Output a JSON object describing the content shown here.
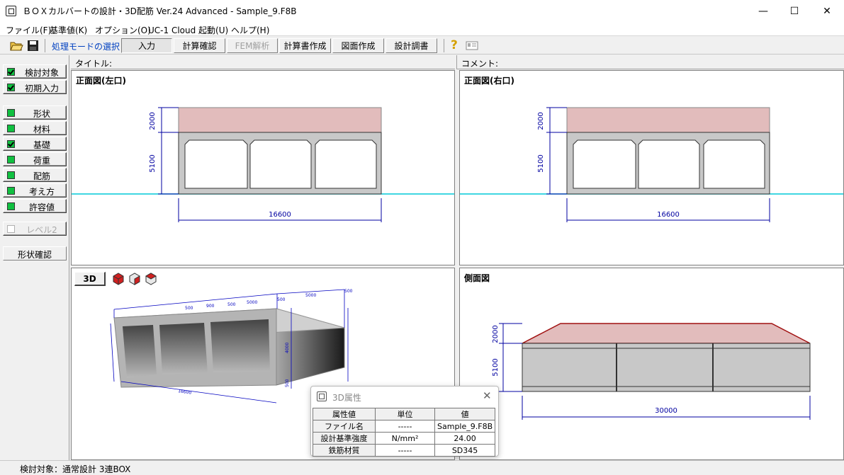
{
  "window": {
    "title": "ＢＯＸカルバートの設計・3D配筋 Ver.24 Advanced - Sample_9.F8B",
    "minimize": "—",
    "maximize": "☐",
    "close": "✕"
  },
  "menu": [
    "ファイル(F)",
    "基準値(K)",
    "オプション(O)",
    "UC-1 Cloud 起動(U)",
    "ヘルプ(H)"
  ],
  "toolbar": {
    "mode_label": "処理モードの選択",
    "modes": [
      "入力",
      "計算確認",
      "FEM解析",
      "計算書作成",
      "図面作成",
      "設計調書"
    ],
    "help_glyph": "?"
  },
  "sidebar": {
    "items": [
      "検討対象",
      "初期入力",
      "形状",
      "材料",
      "基礎",
      "荷重",
      "配筋",
      "考え方",
      "許容値",
      "レベル2",
      "形状確認"
    ]
  },
  "headers": {
    "title_label": "タイトル:",
    "comment_label": "コメント:"
  },
  "panes": {
    "front_left": {
      "title": "正面図(左口)",
      "dims": {
        "top": "2000",
        "wall": "5100",
        "width": "16600"
      }
    },
    "front_right": {
      "title": "正面図(右口)",
      "dims": {
        "top": "2000",
        "wall": "5100",
        "width": "16600"
      }
    },
    "view3d": {
      "button": "3D",
      "dims": [
        "500",
        "5000",
        "500",
        "5000",
        "500",
        "900",
        "500",
        "4000",
        "500",
        "16600"
      ]
    },
    "side": {
      "title": "側面図",
      "dims": {
        "top": "2000",
        "wall": "5100",
        "length": "30000"
      }
    }
  },
  "dialog": {
    "title": "3D属性",
    "close": "✕",
    "headers": [
      "属性値",
      "単位",
      "値"
    ],
    "rows": [
      [
        "ファイル名",
        "-----",
        "Sample_9.F8B"
      ],
      [
        "設計基準強度",
        "N/mm²",
        "24.00"
      ],
      [
        "鉄筋材質",
        "-----",
        "SD345"
      ]
    ]
  },
  "status": {
    "text": "検討対象：通常設計 3連BOX"
  },
  "colors": {
    "fill_soil": "#e2bcbc",
    "fill_concrete": "#c8c8c8",
    "dim_line": "#0000a0",
    "ground_line": "#00c8d8",
    "check_green": "#10c040"
  }
}
